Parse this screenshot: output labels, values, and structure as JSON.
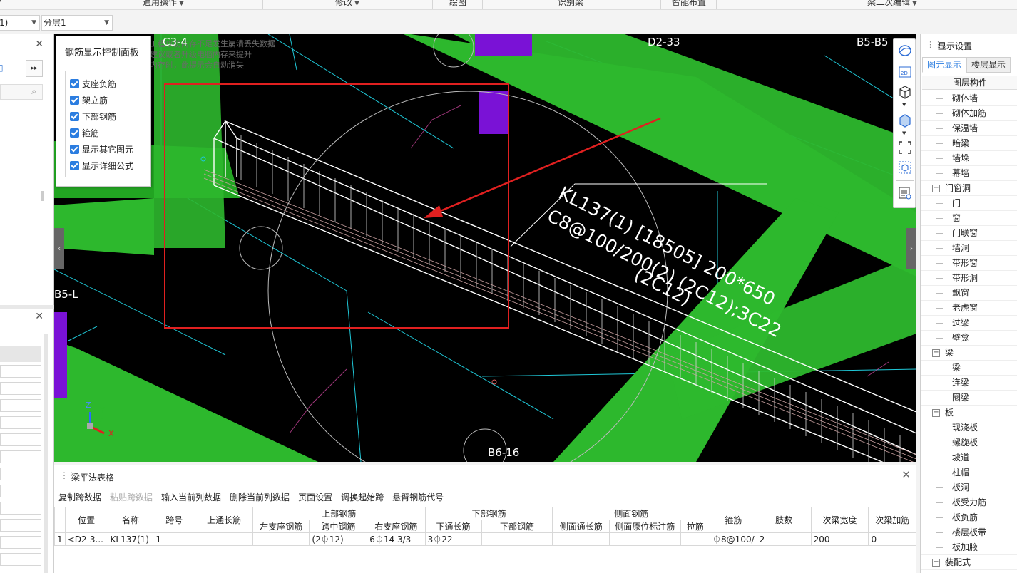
{
  "ribbon": {
    "groups": [
      "通用操作",
      "修改",
      "绘图",
      "识别梁",
      "智能布置",
      "梁二次编辑"
    ]
  },
  "toolbar": {
    "combo_left": "1)",
    "layer_select": "分层1"
  },
  "rebar_panel": {
    "title": "钢筋显示控制面板",
    "options": [
      "支座负筋",
      "架立筋",
      "下部钢筋",
      "箍筋",
      "显示其它图元",
      "显示详细公式"
    ]
  },
  "viewport": {
    "notice": [
      "工程以防内存不足发生崩溃丢失数据",
      "建议或者升级电脑内存来提升",
      "内存时，此提示会自动消失"
    ],
    "labels": {
      "c3": "C3-4",
      "d2": "D2-33",
      "b5r": "B5-B5",
      "b5l": "B5-L",
      "b6": "B6-16"
    },
    "beam_annotation": {
      "line1": "KL137(1) [18505] 200*650",
      "line2": "C8@100/200(2) (2C12);3C22",
      "line3": "(2C12)"
    },
    "axis": {
      "x": "X",
      "y": "Y",
      "z": "Z"
    }
  },
  "table_panel": {
    "title": "梁平法表格",
    "tools": [
      "复制跨数据",
      "粘贴跨数据",
      "输入当前列数据",
      "删除当前列数据",
      "页面设置",
      "调换起始跨",
      "悬臂钢筋代号"
    ],
    "group_headers": {
      "top": "上部钢筋",
      "bottom": "下部钢筋",
      "side": "侧面钢筋"
    },
    "columns": {
      "pos": "位置",
      "name": "名称",
      "span": "跨号",
      "top_through": "上通长筋",
      "left_seat": "左支座钢筋",
      "mid_span": "跨中钢筋",
      "right_seat": "右支座钢筋",
      "bot_through": "下通长筋",
      "bot_rebar": "下部钢筋",
      "side_through": "侧面通长筋",
      "side_orig": "侧面原位标注筋",
      "tie": "拉筋",
      "stirrup": "箍筋",
      "legs": "肢数",
      "sec_width": "次梁宽度",
      "sec_add": "次梁加筋"
    },
    "row": {
      "idx": "1",
      "pos": "<D2-3...",
      "name": "KL137(1)",
      "span": "1",
      "top_through": "",
      "left_seat": "",
      "mid_span": "(2⏁12)",
      "right_seat": "6⏁14 3/3",
      "bot_through": "3⏁22",
      "bot_rebar": "",
      "side_through": "",
      "side_orig": "",
      "tie": "",
      "stirrup": "⏁8@100/",
      "legs": "2",
      "sec_width": "200",
      "sec_add": "0"
    }
  },
  "right_panel": {
    "title": "显示设置",
    "tabs": [
      "图元显示",
      "楼层显示"
    ],
    "tree_header": "图层构件",
    "items": [
      {
        "label": "砌体墙",
        "level": 2
      },
      {
        "label": "砌体加筋",
        "level": 2
      },
      {
        "label": "保温墙",
        "level": 2
      },
      {
        "label": "暗梁",
        "level": 2
      },
      {
        "label": "墙垛",
        "level": 2
      },
      {
        "label": "幕墙",
        "level": 2
      },
      {
        "label": "门窗洞",
        "level": 1
      },
      {
        "label": "门",
        "level": 2
      },
      {
        "label": "窗",
        "level": 2
      },
      {
        "label": "门联窗",
        "level": 2
      },
      {
        "label": "墙洞",
        "level": 2
      },
      {
        "label": "带形窗",
        "level": 2
      },
      {
        "label": "带形洞",
        "level": 2
      },
      {
        "label": "飘窗",
        "level": 2
      },
      {
        "label": "老虎窗",
        "level": 2
      },
      {
        "label": "过梁",
        "level": 2
      },
      {
        "label": "壁龛",
        "level": 2
      },
      {
        "label": "梁",
        "level": 1
      },
      {
        "label": "梁",
        "level": 2
      },
      {
        "label": "连梁",
        "level": 2
      },
      {
        "label": "圈梁",
        "level": 2
      },
      {
        "label": "板",
        "level": 1
      },
      {
        "label": "现浇板",
        "level": 2
      },
      {
        "label": "螺旋板",
        "level": 2
      },
      {
        "label": "坡道",
        "level": 2
      },
      {
        "label": "柱帽",
        "level": 2
      },
      {
        "label": "板洞",
        "level": 2
      },
      {
        "label": "板受力筋",
        "level": 2
      },
      {
        "label": "板负筋",
        "level": 2
      },
      {
        "label": "楼层板带",
        "level": 2
      },
      {
        "label": "板加腋",
        "level": 2
      },
      {
        "label": "装配式",
        "level": 1
      }
    ]
  },
  "colors": {
    "beam_green": "#2db82d",
    "column_purple": "#7a12d6",
    "highlight_red": "#e02020",
    "axis_cyan": "#1fc8d8",
    "accent_blue": "#2b7de0"
  }
}
